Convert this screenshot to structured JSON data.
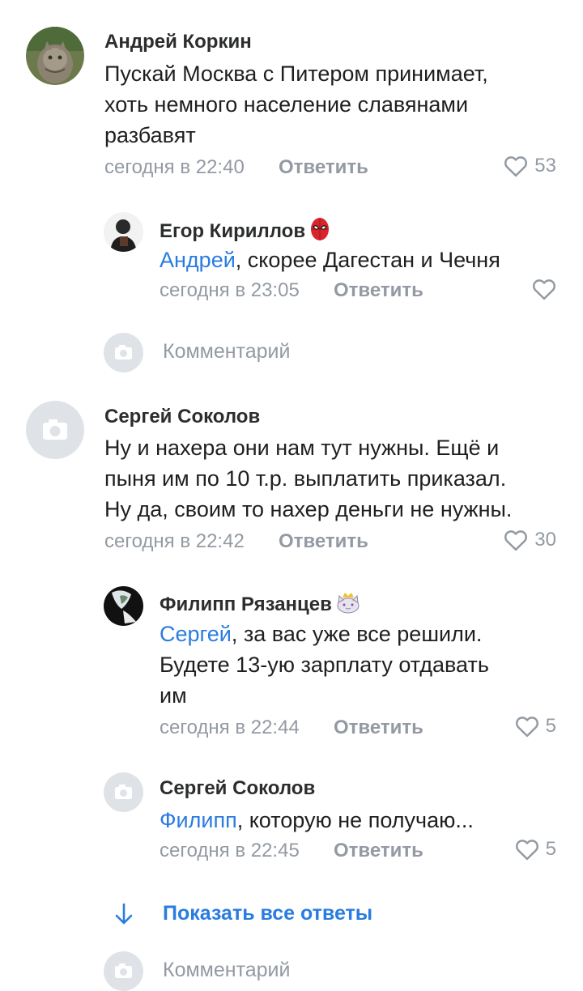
{
  "comments": [
    {
      "author": "Андрей Коркин",
      "lines": [
        "Пускай Москва с Питером принимает,",
        "хоть немного население славянами",
        "разбавят"
      ],
      "time": "сегодня в 22:40",
      "reply_label": "Ответить",
      "likes": "53",
      "avatar_icon": "cat-photo",
      "replies": [
        {
          "author": "Егор Кириллов",
          "badge_icon": "spider-man-emoji",
          "mention": "Андрей",
          "text": ", скорее Дагестан и Чечня",
          "time": "сегодня в 23:05",
          "reply_label": "Ответить",
          "likes": ""
        }
      ],
      "reply_input_placeholder": "Комментарий"
    },
    {
      "author": "Сергей Соколов",
      "lines": [
        "Ну и нахера они нам тут нужны. Ещё и",
        "пыня им по 10 т.р. выплатить приказал.",
        "Ну да, своим то нахер деньги не нужны."
      ],
      "time": "сегодня в 22:42",
      "reply_label": "Ответить",
      "likes": "30",
      "avatar_icon": "camera-icon",
      "replies": [
        {
          "author": "Филипп Рязанцев",
          "badge_icon": "crowned-cat-emoji",
          "mention": "Сергей",
          "text": ", за вас уже все решили.",
          "lines": [
            "Будете 13-ую зарплату отдавать",
            "им"
          ],
          "time": "сегодня в 22:44",
          "reply_label": "Ответить",
          "likes": "5"
        },
        {
          "author": "Сергей Соколов",
          "mention": "Филипп",
          "text": ", которую не получаю...",
          "time": "сегодня в 22:45",
          "reply_label": "Ответить",
          "likes": "5"
        }
      ],
      "show_all_label": "Показать все ответы",
      "reply_input_placeholder": "Комментарий"
    }
  ],
  "colors": {
    "link": "#2a7ce0",
    "meta": "#939aa3",
    "placeholder_avatar": "#dfe3e8"
  }
}
